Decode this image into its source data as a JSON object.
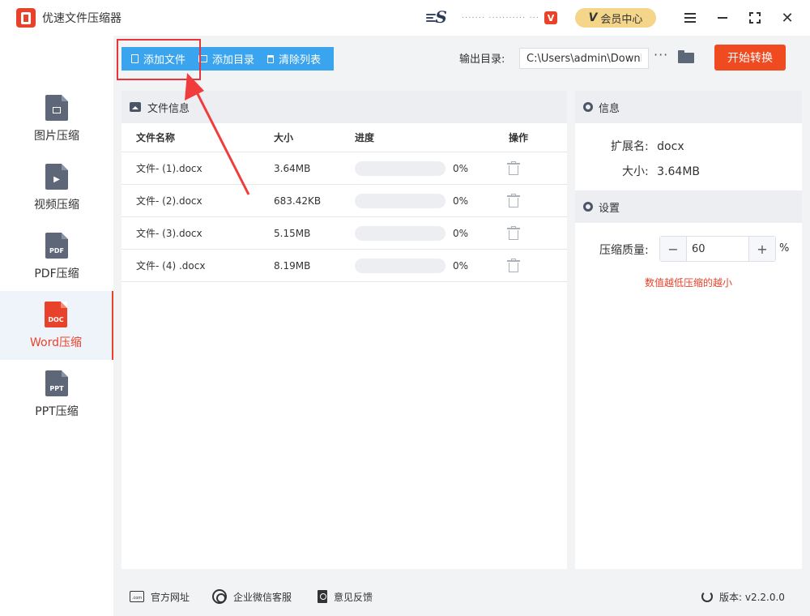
{
  "app": {
    "title": "优速文件压缩器"
  },
  "titlebar": {
    "user_name": "·······  ···········  ···",
    "vip_badge": "V",
    "member_center": "会员中心",
    "member_v": "V"
  },
  "sidebar": {
    "items": [
      {
        "label": "图片压缩",
        "icon_text": ""
      },
      {
        "label": "视频压缩",
        "icon_text": "▶"
      },
      {
        "label": "PDF压缩",
        "icon_text": "PDF"
      },
      {
        "label": "Word压缩",
        "icon_text": "DOC",
        "active": true
      },
      {
        "label": "PPT压缩",
        "icon_text": "PPT"
      }
    ]
  },
  "toolbar": {
    "add_file": "添加文件",
    "add_dir": "添加目录",
    "clear_list": "清除列表",
    "output_label": "输出目录:",
    "output_path": "C:\\Users\\admin\\Downlo",
    "more": "···",
    "start": "开始转换"
  },
  "file_panel": {
    "title": "文件信息",
    "columns": {
      "name": "文件名称",
      "size": "大小",
      "progress": "进度",
      "ops": "操作"
    },
    "rows": [
      {
        "name": "文件- (1).docx",
        "size": "3.64MB",
        "progress": 0,
        "pct": "0%"
      },
      {
        "name": "文件- (2).docx",
        "size": "683.42KB",
        "progress": 0,
        "pct": "0%"
      },
      {
        "name": "文件- (3).docx",
        "size": "5.15MB",
        "progress": 0,
        "pct": "0%"
      },
      {
        "name": "文件- (4) .docx",
        "size": "8.19MB",
        "progress": 0,
        "pct": "0%"
      }
    ]
  },
  "info_panel": {
    "info_title": "信息",
    "ext_label": "扩展名:",
    "ext_value": "docx",
    "size_label": "大小:",
    "size_value": "3.64MB",
    "settings_title": "设置",
    "quality_label": "压缩质量:",
    "quality_value": "60",
    "minus": "−",
    "plus": "+",
    "percent": "%",
    "hint": "数值越低压缩的越小"
  },
  "footer": {
    "website": "官方网址",
    "wechat": "企业微信客服",
    "feedback": "意见反馈",
    "version": "版本: v2.2.0.0",
    "com_icon_text": ".com"
  },
  "colors": {
    "accent": "#3aa5ee",
    "brand": "#e8432a",
    "start": "#f04b20"
  }
}
